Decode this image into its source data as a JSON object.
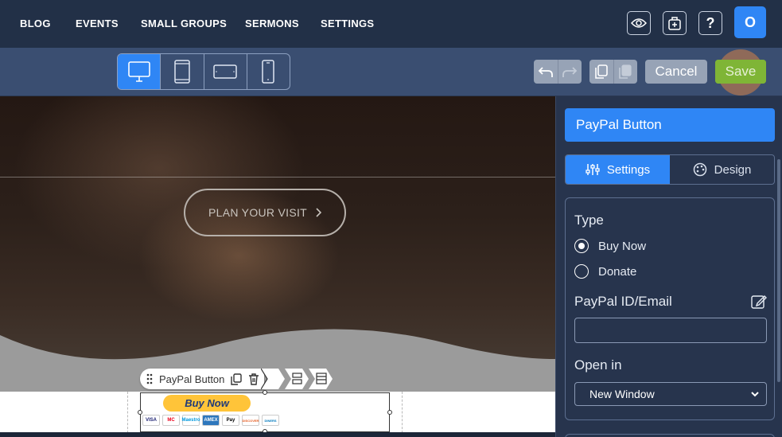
{
  "nav": {
    "items": [
      "BLOG",
      "EVENTS",
      "SMALL GROUPS",
      "SERMONS",
      "SETTINGS"
    ],
    "avatar_initial": "O",
    "icons": [
      "eye-icon",
      "site-kit-icon",
      "help-icon"
    ]
  },
  "toolbar": {
    "devices": [
      "desktop",
      "tablet",
      "tablet-landscape",
      "mobile"
    ],
    "active_device": "desktop",
    "cancel_label": "Cancel",
    "save_label": "Save"
  },
  "canvas": {
    "plan_visit_label": "PLAN YOUR VISIT",
    "widget_label": "PayPal Button",
    "paypal_button_label": "Buy Now",
    "cards": [
      "VISA",
      "MC",
      "Maestro",
      "AMEX",
      "Pay",
      "DISCOVER",
      "DINERS"
    ]
  },
  "panel": {
    "title": "PayPal Button",
    "tabs": [
      "Settings",
      "Design"
    ],
    "active_tab": "Settings",
    "type_label": "Type",
    "type_options": [
      "Buy Now",
      "Donate"
    ],
    "type_selected": "Buy Now",
    "paypal_id_label": "PayPal ID/Email",
    "paypal_id_value": "",
    "open_in_label": "Open in",
    "open_in_value": "New Window"
  },
  "colors": {
    "accent": "#2f86f5",
    "save": "#7fb536",
    "nav_bg": "#223047",
    "toolbar_bg": "#3a4e71",
    "panel_bg": "#27344d"
  }
}
